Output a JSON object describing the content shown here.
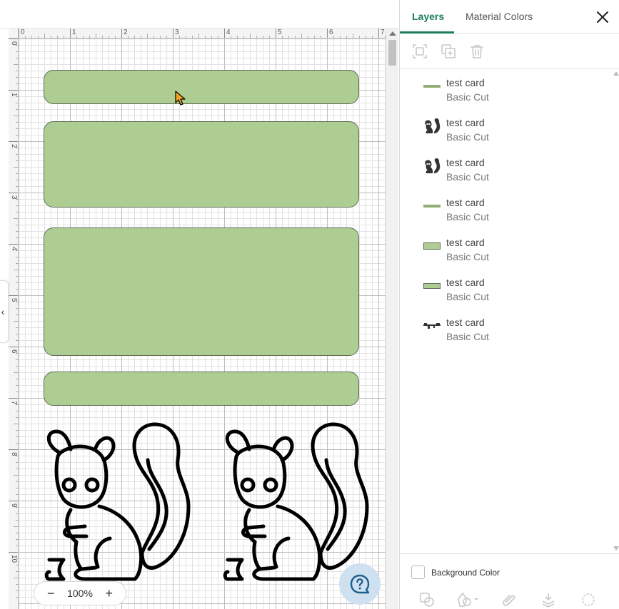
{
  "ruler": {
    "x_labels": [
      "0",
      "1",
      "2",
      "3",
      "4",
      "5",
      "6",
      "7"
    ],
    "y_labels": [
      "0",
      "1",
      "2",
      "3",
      "4",
      "5",
      "6",
      "7",
      "8",
      "9",
      "10"
    ]
  },
  "canvas": {
    "zoom_label": "100%",
    "zoom_out_symbol": "−",
    "zoom_in_symbol": "+",
    "collapse_symbol": "‹",
    "shape_fill_color": "#aecd92",
    "shape_stroke_color": "#5f6b57"
  },
  "panel": {
    "tabs": [
      {
        "label": "Layers",
        "active": true
      },
      {
        "label": "Material Colors",
        "active": false
      }
    ],
    "accent_color": "#1a7f5a",
    "toolbar_icons": [
      "group-icon",
      "duplicate-icon",
      "delete-icon"
    ],
    "layers": [
      {
        "name": "test card",
        "operation": "Basic Cut",
        "thumb": "line"
      },
      {
        "name": "test card",
        "operation": "Basic Cut",
        "thumb": "squirrel"
      },
      {
        "name": "test card",
        "operation": "Basic Cut",
        "thumb": "squirrel"
      },
      {
        "name": "test card",
        "operation": "Basic Cut",
        "thumb": "line"
      },
      {
        "name": "test card",
        "operation": "Basic Cut",
        "thumb": "rect"
      },
      {
        "name": "test card",
        "operation": "Basic Cut",
        "thumb": "rect"
      },
      {
        "name": "test card",
        "operation": "Basic Cut",
        "thumb": "text"
      }
    ],
    "background_color_label": "Background Color",
    "bottom_icons": [
      "slice-icon",
      "combine-icon",
      "attach-icon",
      "flatten-icon",
      "contour-icon"
    ]
  }
}
